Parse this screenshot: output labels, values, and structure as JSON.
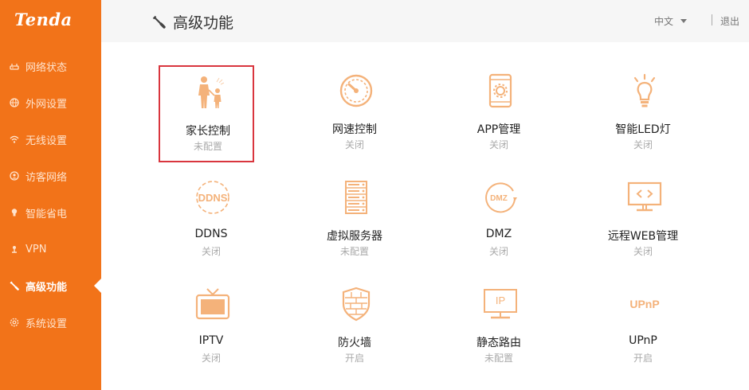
{
  "brand": {
    "logo_text": "Tenda",
    "accent": "#f27319",
    "highlight": "#d9363e",
    "icon_color": "#f4b27a"
  },
  "sidebar": {
    "items": [
      {
        "label": "网络状态",
        "icon": "router-icon",
        "active": false
      },
      {
        "label": "外网设置",
        "icon": "globe-icon",
        "active": false
      },
      {
        "label": "无线设置",
        "icon": "wifi-icon",
        "active": false
      },
      {
        "label": "访客网络",
        "icon": "guest-icon",
        "active": false
      },
      {
        "label": "智能省电",
        "icon": "bulb-icon",
        "active": false
      },
      {
        "label": "VPN",
        "icon": "vpn-icon",
        "active": false
      },
      {
        "label": "高级功能",
        "icon": "wrench-icon",
        "active": true
      },
      {
        "label": "系统设置",
        "icon": "gear-icon",
        "active": false
      }
    ]
  },
  "header": {
    "title": "高级功能",
    "title_icon": "wrench-icon",
    "language": "中文",
    "logout": "退出"
  },
  "features": [
    {
      "name": "家长控制",
      "status": "未配置",
      "icon": "parental-control-icon",
      "selected": true
    },
    {
      "name": "网速控制",
      "status": "关闭",
      "icon": "speedometer-icon",
      "selected": false
    },
    {
      "name": "APP管理",
      "status": "关闭",
      "icon": "app-management-icon",
      "selected": false
    },
    {
      "name": "智能LED灯",
      "status": "关闭",
      "icon": "led-bulb-icon",
      "selected": false
    },
    {
      "name": "DDNS",
      "status": "关闭",
      "icon": "ddns-icon",
      "icon_text": "DDNS",
      "selected": false
    },
    {
      "name": "虚拟服务器",
      "status": "未配置",
      "icon": "server-rack-icon",
      "selected": false
    },
    {
      "name": "DMZ",
      "status": "关闭",
      "icon": "dmz-icon",
      "icon_text": "DMZ",
      "selected": false
    },
    {
      "name": "远程WEB管理",
      "status": "关闭",
      "icon": "remote-web-icon",
      "selected": false
    },
    {
      "name": "IPTV",
      "status": "关闭",
      "icon": "tv-icon",
      "selected": false
    },
    {
      "name": "防火墙",
      "status": "开启",
      "icon": "firewall-shield-icon",
      "selected": false
    },
    {
      "name": "静态路由",
      "status": "未配置",
      "icon": "static-route-icon",
      "icon_text": "IP",
      "selected": false
    },
    {
      "name": "UPnP",
      "status": "开启",
      "icon": "upnp-icon",
      "icon_text": "UPnP",
      "selected": false
    }
  ]
}
